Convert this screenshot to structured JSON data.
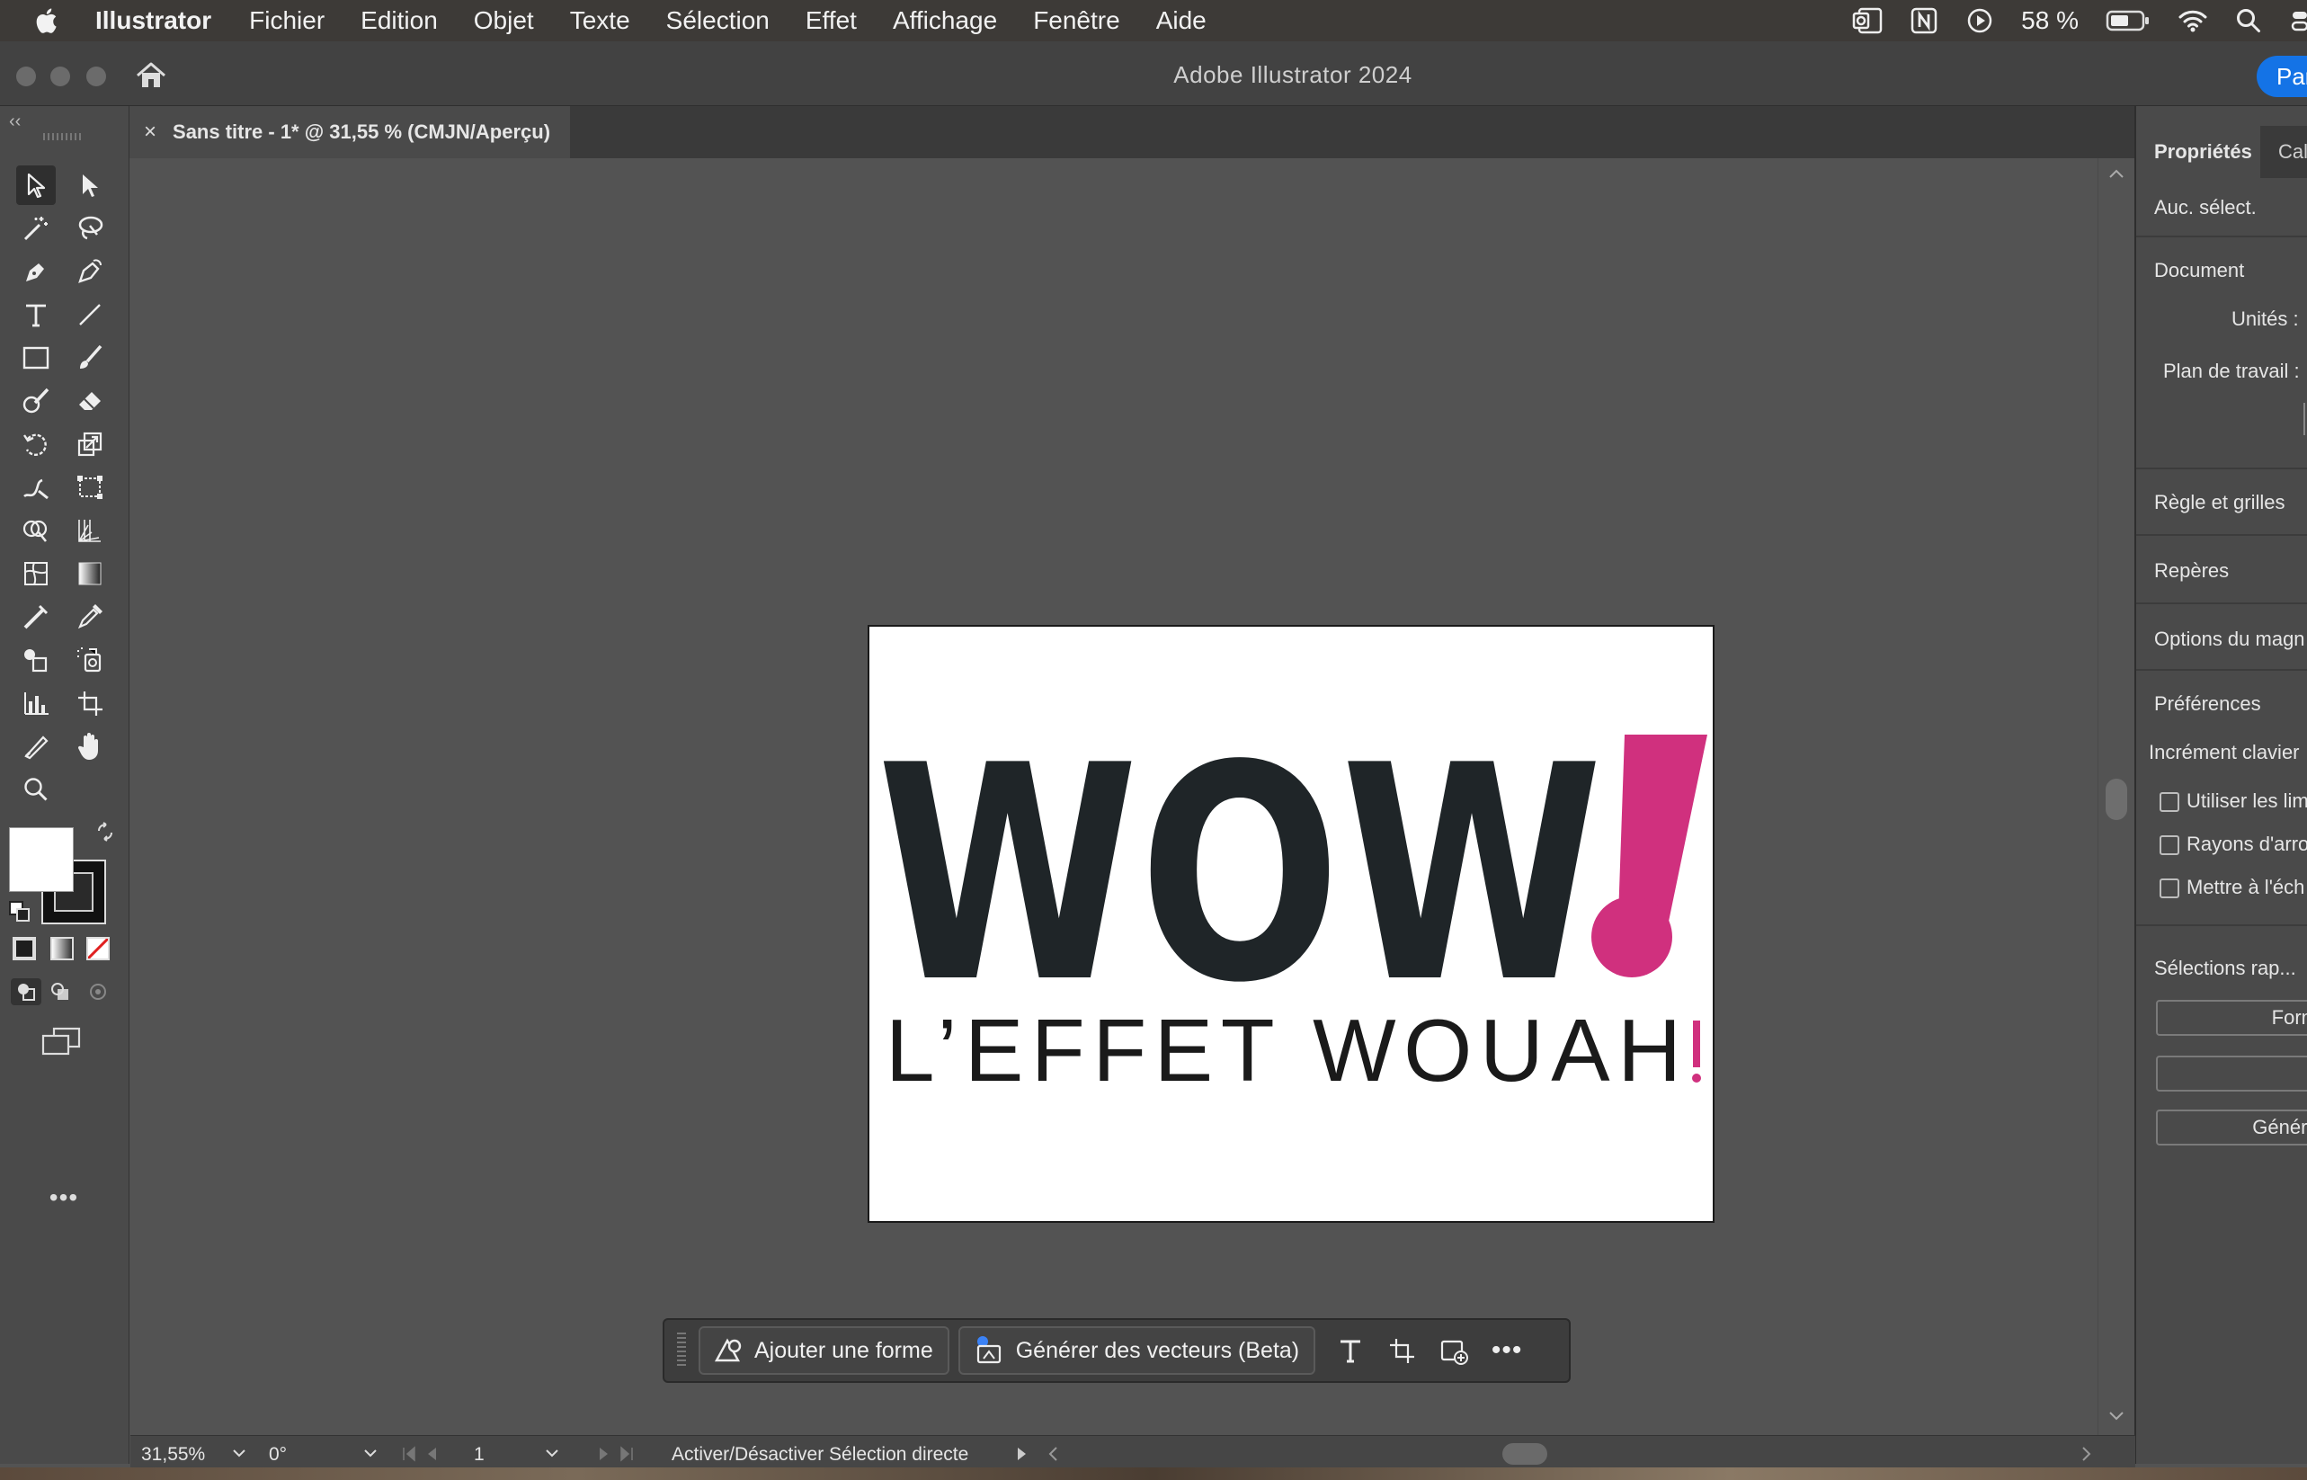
{
  "menubar": {
    "app_name": "Illustrator",
    "menus": [
      "Fichier",
      "Edition",
      "Objet",
      "Texte",
      "Sélection",
      "Effet",
      "Affichage",
      "Fenêtre",
      "Aide"
    ],
    "battery": "58 %"
  },
  "window": {
    "title": "Adobe Illustrator 2024",
    "share_label": "Par"
  },
  "document_tab": {
    "close_symbol": "×",
    "title": "Sans titre - 1* @ 31,55 % (CMJN/Aperçu)"
  },
  "artwork": {
    "headline": "WOW",
    "headline_mark": "!",
    "tagline": "L’EFFET WOUAH",
    "tagline_mark": "!",
    "colors": {
      "dark": "#1f2528",
      "accent": "#d0307e"
    }
  },
  "properties": {
    "tab_active": "Propriétés",
    "tab_other": "Cal",
    "no_selection": "Auc. sélect.",
    "document_heading": "Document",
    "units_label": "Unités :",
    "artboard_label": "Plan de travail :",
    "rulers_grids": "Règle et grilles",
    "guides": "Repères",
    "snap_options": "Options du magn",
    "preferences": "Préférences",
    "keyboard_increment": "Incrément clavier",
    "checkboxes": [
      "Utiliser les lim",
      "Rayons d'arro",
      "Mettre à l'éch"
    ],
    "quick_actions": "Sélections rap...",
    "button_forms": "Form",
    "button_generate": "Générer"
  },
  "taskbar": {
    "add_shape": "Ajouter une forme",
    "generate_vectors": "Générer des vecteurs (Beta)"
  },
  "statusbar": {
    "zoom": "31,55%",
    "rotation": "0°",
    "artboard_number": "1",
    "status_text": "Activer/Désactiver Sélection directe"
  }
}
